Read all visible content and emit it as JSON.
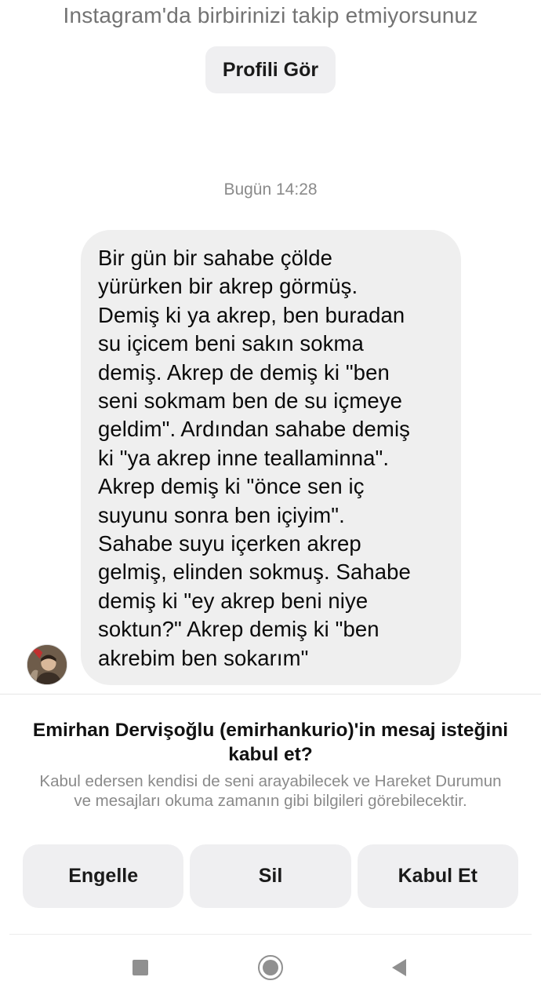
{
  "header": {
    "follow_notice": "Instagram'da birbirinizi takip etmiyorsunuz",
    "view_profile_label": "Profili Gör"
  },
  "conversation": {
    "timestamp": "Bugün 14:28",
    "message_text": "Bir gün bir sahabe çölde\nyürürken bir akrep görmüş.\nDemiş ki ya akrep, ben buradan\nsu içicem beni sakın sokma\ndemiş. Akrep de demiş ki \"ben\nseni sokmam ben de su içmeye\ngeldim\". Ardından sahabe demiş\nki \"ya akrep inne teallaminna\".\nAkrep demiş ki \"önce sen iç\nsuyunu sonra ben içiyim\".\nSahabe suyu içerken akrep\ngelmiş, elinden sokmuş. Sahabe\ndemiş ki \"ey akrep beni niye\nsoktun?\" Akrep demiş ki \"ben\nakrebim ben sokarım\""
  },
  "request": {
    "title": "Emirhan Dervişoğlu (emirhankurio)'in mesaj isteğini kabul et?",
    "description": "Kabul edersen kendisi de seni arayabilecek ve Hareket Durumun ve mesajları okuma zamanın gibi bilgileri görebilecektir.",
    "actions": {
      "block_label": "Engelle",
      "delete_label": "Sil",
      "accept_label": "Kabul Et"
    }
  },
  "system_nav": {
    "icons": [
      "recent-apps-icon",
      "home-icon",
      "back-icon"
    ]
  },
  "colors": {
    "bubble": "#efefef",
    "button": "#efeff1",
    "muted_text": "#737373"
  }
}
